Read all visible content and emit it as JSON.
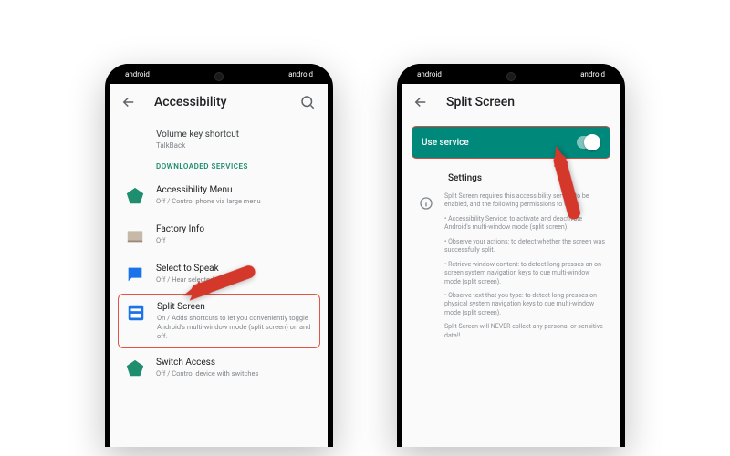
{
  "statusbar": {
    "left": "android",
    "right": "android"
  },
  "phone1": {
    "title": "Accessibility",
    "volume": {
      "title": "Volume key shortcut",
      "sub": "TalkBack"
    },
    "section": "DOWNLOADED SERVICES",
    "services": [
      {
        "title": "Accessibility Menu",
        "sub": "Off / Control phone via large menu"
      },
      {
        "title": "Factory Info",
        "sub": "Off"
      },
      {
        "title": "Select to Speak",
        "sub": "Off / Hear selected text"
      },
      {
        "title": "Split Screen",
        "sub": "On / Adds shortcuts to let you conveniently toggle Android's multi-window mode (split screen) on and off."
      },
      {
        "title": "Switch Access",
        "sub": "Off / Control device with switches"
      }
    ]
  },
  "phone2": {
    "title": "Split Screen",
    "banner": "Use service",
    "settings_label": "Settings",
    "info": [
      "Split Screen requires this accessibility service to be enabled, and the following permissions to work:",
      "• Accessibility Service: to activate and deactivate Android's multi-window mode (split screen).",
      "• Observe your actions: to detect whether the screen was successfully split.",
      "• Retrieve window content: to detect long presses on on-screen system navigation keys to cue multi-window mode (split screen).",
      "• Observe text that you type: to detect long presses on physical system navigation keys to cue multi-window mode (split screen).",
      "Split Screen will NEVER collect any personal or sensitive data!!"
    ]
  }
}
